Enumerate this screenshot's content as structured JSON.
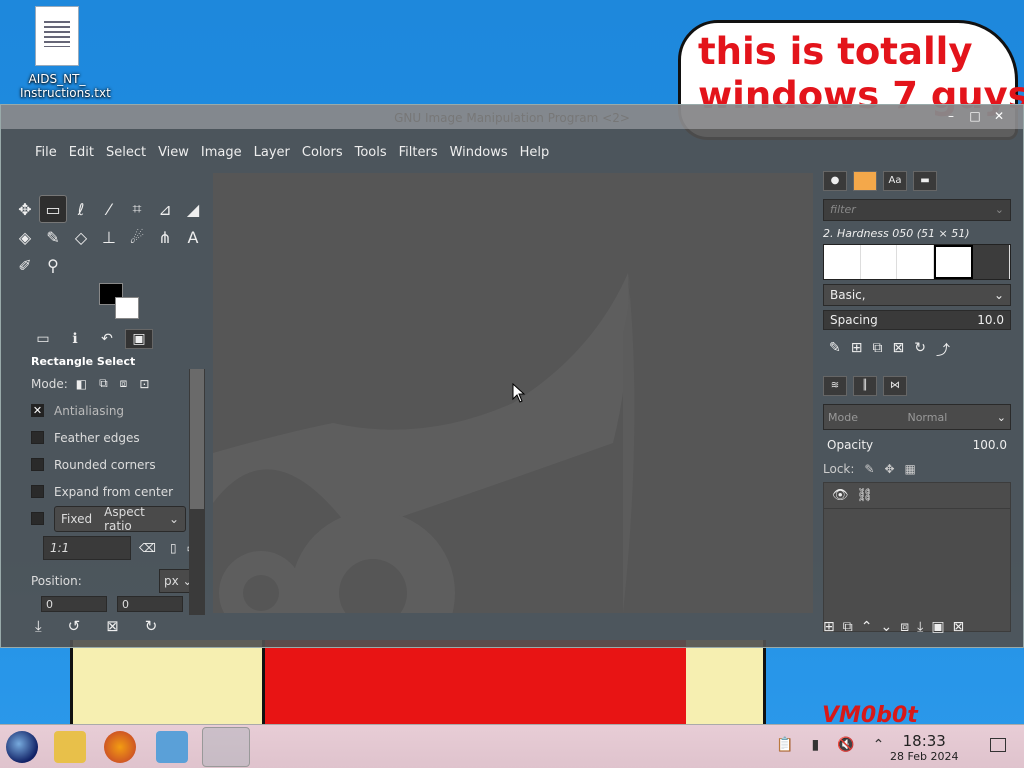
{
  "desktop": {
    "icon_label_line1": "AIDS_NT_",
    "icon_label_line2": "Instructions.txt",
    "meme_text": "this is totally\nwindows 7 guys",
    "signature": "VM0b0t"
  },
  "window": {
    "title": "GNU Image Manipulation Program <2>",
    "controls": [
      "–",
      "□",
      "✕"
    ]
  },
  "menu": {
    "items": [
      "File",
      "Edit",
      "Select",
      "View",
      "Image",
      "Layer",
      "Colors",
      "Tools",
      "Filters",
      "Windows",
      "Help"
    ]
  },
  "tool_options": {
    "title": "Rectangle Select",
    "mode_label": "Mode:",
    "antialiasing": "Antialiasing",
    "feather": "Feather edges",
    "rounded": "Rounded corners",
    "expand": "Expand from center",
    "fixed": "Fixed",
    "fixed_option": "Aspect ratio",
    "ratio_value": "1:1",
    "position_label": "Position:",
    "unit": "px",
    "pos_x": "0",
    "pos_y": "0"
  },
  "brushes": {
    "filter_placeholder": "filter",
    "current": "2. Hardness 050 (51 × 51)",
    "preset": "Basic,",
    "spacing_label": "Spacing",
    "spacing_value": "10.0"
  },
  "layers": {
    "mode_label": "Mode",
    "mode_value": "Normal",
    "opacity_label": "Opacity",
    "opacity_value": "100.0",
    "lock_label": "Lock:"
  },
  "taskbar": {
    "time": "18:33",
    "date": "28 Feb 2024"
  }
}
